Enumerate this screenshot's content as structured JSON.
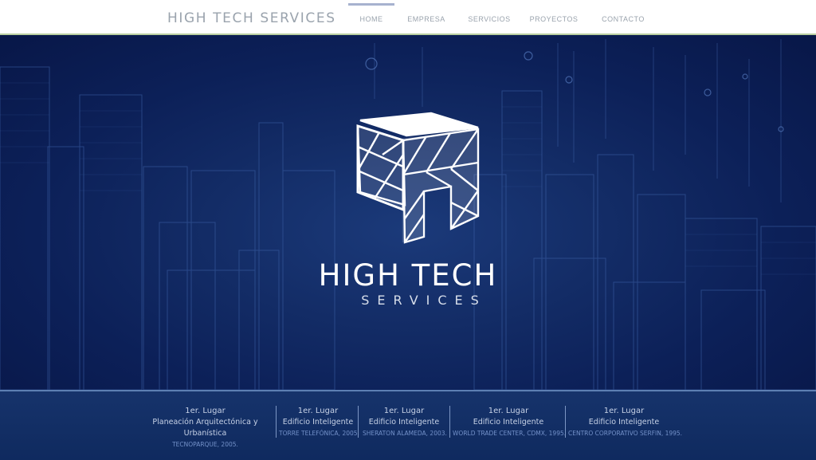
{
  "header": {
    "brand": "HIGH TECH SERVICES",
    "nav": [
      {
        "label": "HOME",
        "active": true
      },
      {
        "label": "EMPRESA",
        "active": false
      },
      {
        "label": "SERVICIOS",
        "active": false
      },
      {
        "label": "PROYECTOS",
        "active": false
      },
      {
        "label": "CONTACTO",
        "active": false
      }
    ]
  },
  "hero": {
    "logo_title": "HIGH TECH",
    "logo_subtitle": "SERVICES",
    "background": "city-skyline-blueprint"
  },
  "awards": [
    {
      "place": "1er. Lugar",
      "category": "Planeación Arquitectónica y Urbanística",
      "project": "TECNOPARQUE, 2005."
    },
    {
      "place": "1er. Lugar",
      "category": "Edificio Inteligente",
      "project": "TORRE TELEFÓNICA, 2005."
    },
    {
      "place": "1er. Lugar",
      "category": "Edificio Inteligente",
      "project": "SHERATON ALAMEDA, 2003."
    },
    {
      "place": "1er. Lugar",
      "category": "Edificio Inteligente",
      "project": "WORLD TRADE CENTER, CDMX, 1995."
    },
    {
      "place": "1er. Lugar",
      "category": "Edificio Inteligente",
      "project": "CENTRO CORPORATIVO SERFIN, 1995."
    }
  ],
  "colors": {
    "header_bg": "#ffffff",
    "header_text": "#9aa3ad",
    "hero_bg": "#0c2058",
    "band_bg": "#16336b",
    "project_text": "#7391c9"
  }
}
